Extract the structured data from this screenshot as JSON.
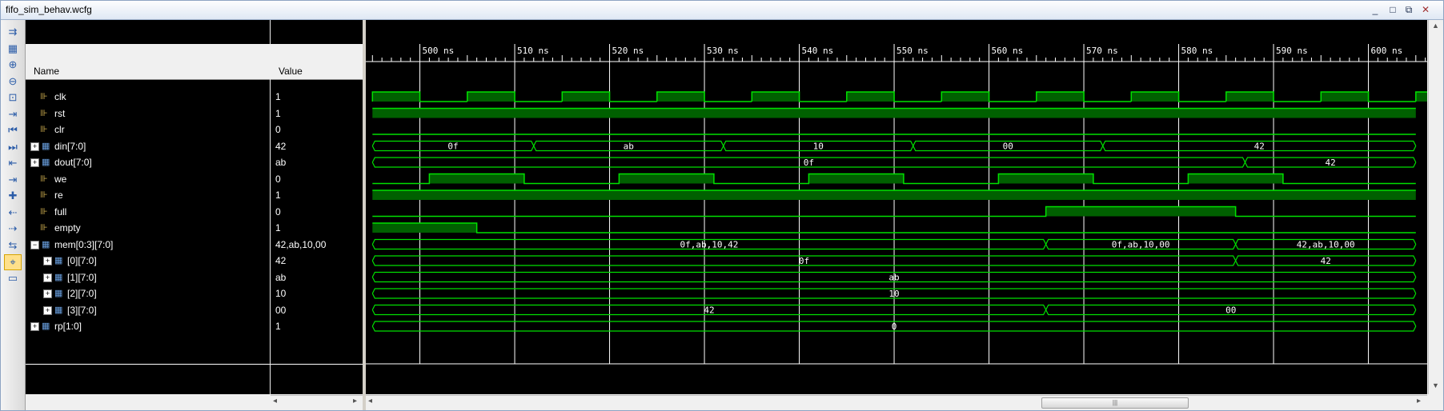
{
  "window": {
    "title": "fifo_sim_behav.wcfg"
  },
  "headers": {
    "name": "Name",
    "value": "Value"
  },
  "toolbar": [
    "zoom-in-icon",
    "zoom-out-icon",
    "zoom-fit-icon",
    "go-to-cursor-icon",
    "go-to-start-icon",
    "go-to-end-icon",
    "previous-transition-icon",
    "next-transition-icon",
    "add-marker-icon",
    "previous-marker-icon",
    "next-marker-icon",
    "swap-cursors-icon",
    "snap-to-transition-icon",
    "floating-ruler-icon"
  ],
  "time_axis": [
    "500 ns",
    "510 ns",
    "520 ns",
    "530 ns",
    "540 ns",
    "550 ns",
    "560 ns",
    "570 ns",
    "580 ns",
    "590 ns",
    "600 ns"
  ],
  "signals": [
    {
      "name": "clk",
      "value": "1",
      "type": "bit",
      "expand": false,
      "indent": 0
    },
    {
      "name": "rst",
      "value": "1",
      "type": "bit",
      "expand": false,
      "indent": 0
    },
    {
      "name": "clr",
      "value": "0",
      "type": "bit",
      "expand": false,
      "indent": 0
    },
    {
      "name": "din[7:0]",
      "value": "42",
      "type": "bus",
      "expand": true,
      "indent": 0
    },
    {
      "name": "dout[7:0]",
      "value": "ab",
      "type": "bus",
      "expand": true,
      "indent": 0
    },
    {
      "name": "we",
      "value": "0",
      "type": "bit",
      "expand": false,
      "indent": 0
    },
    {
      "name": "re",
      "value": "1",
      "type": "bit",
      "expand": false,
      "indent": 0
    },
    {
      "name": "full",
      "value": "0",
      "type": "bit",
      "expand": false,
      "indent": 0
    },
    {
      "name": "empty",
      "value": "1",
      "type": "bit",
      "expand": false,
      "indent": 0
    },
    {
      "name": "mem[0:3][7:0]",
      "value": "42,ab,10,00",
      "type": "bus",
      "expand": true,
      "indent": 0,
      "expanded": true
    },
    {
      "name": "[0][7:0]",
      "value": "42",
      "type": "bus",
      "expand": true,
      "indent": 1
    },
    {
      "name": "[1][7:0]",
      "value": "ab",
      "type": "bus",
      "expand": true,
      "indent": 1
    },
    {
      "name": "[2][7:0]",
      "value": "10",
      "type": "bus",
      "expand": true,
      "indent": 1
    },
    {
      "name": "[3][7:0]",
      "value": "00",
      "type": "bus",
      "expand": true,
      "indent": 1
    },
    {
      "name": "rp[1:0]",
      "value": "1",
      "type": "bus",
      "expand": true,
      "indent": 0
    }
  ],
  "waves": {
    "clk": {
      "kind": "clock",
      "high_first": true,
      "period_ns": 10,
      "rise_ns": 505
    },
    "rst": {
      "kind": "bit",
      "segments": [
        [
          495,
          605,
          1
        ]
      ]
    },
    "clr": {
      "kind": "bit",
      "segments": [
        [
          495,
          605,
          0
        ]
      ]
    },
    "din": {
      "kind": "bus",
      "segments": [
        [
          495,
          512,
          "0f"
        ],
        [
          512,
          532,
          "ab"
        ],
        [
          532,
          552,
          "10"
        ],
        [
          552,
          572,
          "00"
        ],
        [
          572,
          605,
          "42"
        ]
      ]
    },
    "dout": {
      "kind": "bus",
      "segments": [
        [
          495,
          587,
          "0f"
        ],
        [
          587,
          605,
          "42"
        ]
      ]
    },
    "we": {
      "kind": "bit",
      "segments": [
        [
          495,
          501,
          0
        ],
        [
          501,
          511,
          1
        ],
        [
          511,
          521,
          0
        ],
        [
          521,
          531,
          1
        ],
        [
          531,
          541,
          0
        ],
        [
          541,
          551,
          1
        ],
        [
          551,
          561,
          0
        ],
        [
          561,
          571,
          1
        ],
        [
          571,
          581,
          0
        ],
        [
          581,
          591,
          1
        ],
        [
          591,
          605,
          0
        ]
      ]
    },
    "re": {
      "kind": "bit",
      "segments": [
        [
          495,
          605,
          1
        ]
      ]
    },
    "full": {
      "kind": "bit",
      "segments": [
        [
          495,
          566,
          0
        ],
        [
          566,
          586,
          1
        ],
        [
          586,
          605,
          0
        ]
      ]
    },
    "empty": {
      "kind": "bit",
      "segments": [
        [
          495,
          506,
          1
        ],
        [
          506,
          605,
          0
        ]
      ]
    },
    "mem": {
      "kind": "bus",
      "segments": [
        [
          495,
          566,
          "0f,ab,10,42"
        ],
        [
          566,
          586,
          "0f,ab,10,00"
        ],
        [
          586,
          605,
          "42,ab,10,00"
        ]
      ]
    },
    "m0": {
      "kind": "bus",
      "segments": [
        [
          495,
          586,
          "0f"
        ],
        [
          586,
          605,
          "42"
        ]
      ]
    },
    "m1": {
      "kind": "bus",
      "segments": [
        [
          495,
          605,
          "ab"
        ]
      ]
    },
    "m2": {
      "kind": "bus",
      "segments": [
        [
          495,
          605,
          "10"
        ]
      ]
    },
    "m3": {
      "kind": "bus",
      "segments": [
        [
          495,
          566,
          "42"
        ],
        [
          566,
          605,
          "00"
        ]
      ]
    },
    "rp": {
      "kind": "bus",
      "segments": [
        [
          495,
          605,
          "0"
        ]
      ]
    }
  },
  "colors": {
    "wave": "#00e000",
    "wave_fill": "#006000",
    "grid": "#ffffff",
    "background": "#000000"
  }
}
